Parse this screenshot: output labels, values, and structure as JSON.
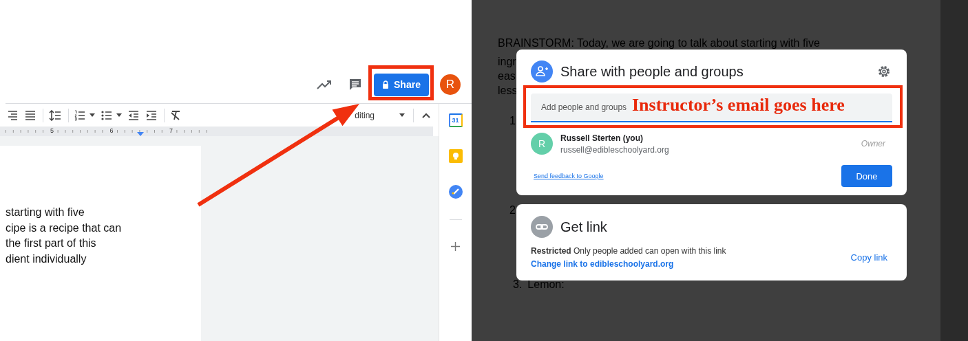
{
  "docs_editor": {
    "share_button": {
      "label": "Share"
    },
    "account_avatar": {
      "initial": "R"
    },
    "toolbar": {
      "mode_label": "diting"
    },
    "ruler": {
      "numbers": [
        "5",
        "6",
        "7"
      ]
    },
    "document_lines": [
      "starting with five",
      "cipe is a recipe that can",
      "the first part of this",
      "dient individually"
    ],
    "side_panel": {
      "calendar_day": "31"
    }
  },
  "background_document": {
    "lines": [
      "BRAINSTORM: Today, we are going to talk about starting with five",
      "ingr",
      "eas",
      "less"
    ],
    "list_items": [
      {
        "number": "1"
      },
      {
        "number": "2"
      },
      {
        "number": "3.",
        "text": "Lemon:"
      }
    ]
  },
  "share_dialog": {
    "title": "Share with people and groups",
    "input": {
      "placeholder": "Add people and groups"
    },
    "people": [
      {
        "initial": "R",
        "name": "Russell Sterten (you)",
        "email": "russell@edibleschoolyard.org",
        "role": "Owner"
      }
    ],
    "feedback_link": "Send feedback to Google",
    "done_button": "Done"
  },
  "link_dialog": {
    "title": "Get link",
    "access": "**Restricted** Only people added can open with this link",
    "change_link": "Change link to edibleschoolyard.org",
    "copy_button": "Copy link"
  },
  "annotations": {
    "callout": "Instructor’s email goes here"
  }
}
